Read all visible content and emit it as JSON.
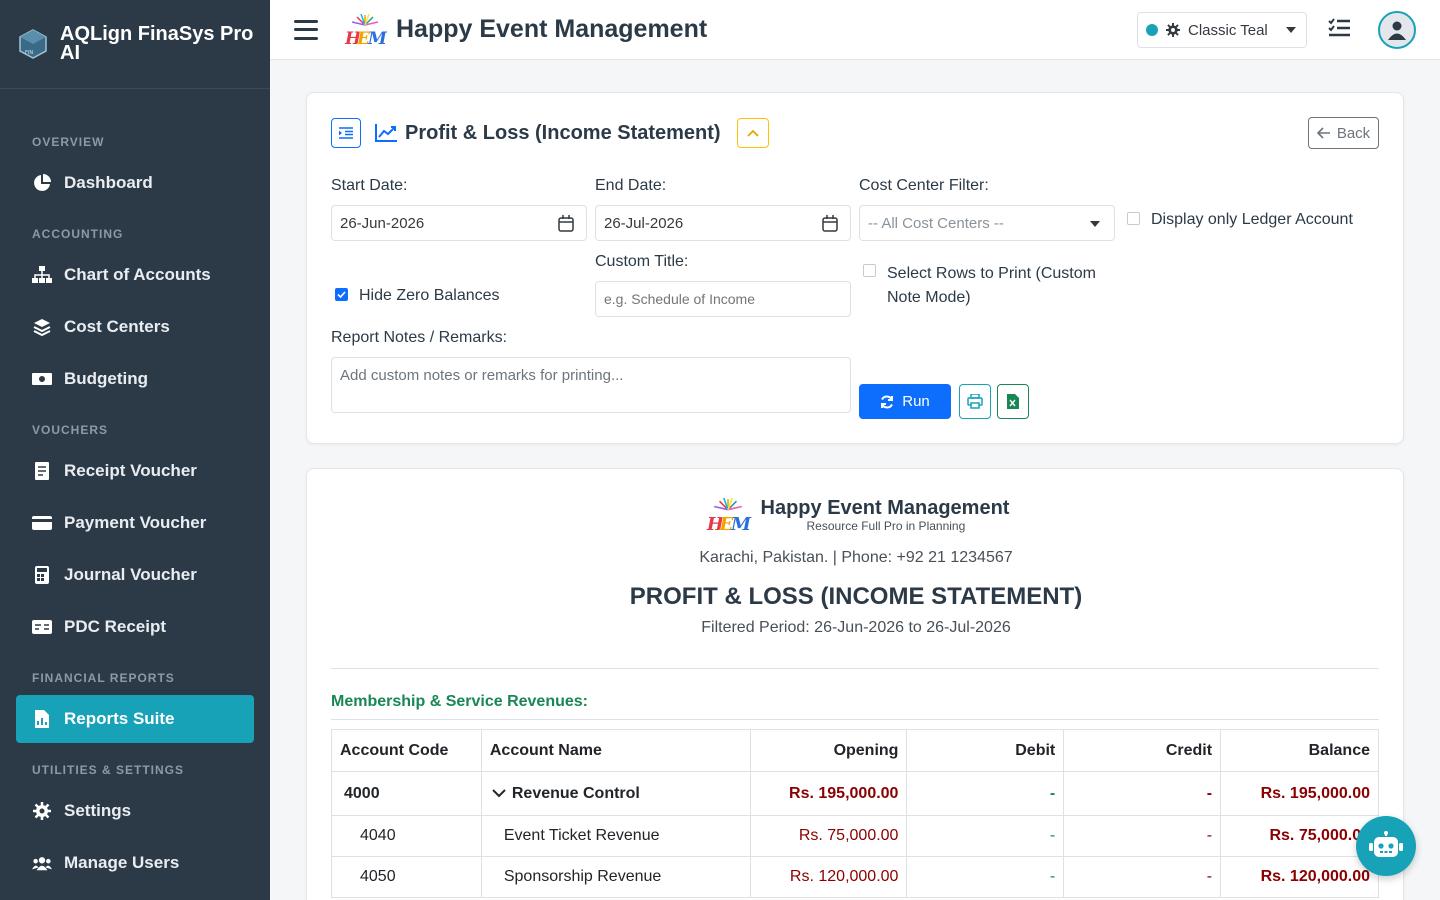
{
  "app": {
    "brand_name": "AQLign FinaSys Pro AI",
    "page_title": "Happy Event Management"
  },
  "colors": {
    "sidebar_bg": "#2c3a47",
    "accent": "#17a2b8",
    "primary": "#0d6efd",
    "revenue_red": "#8b0000",
    "section_green": "#198754"
  },
  "sidebar": {
    "sections": [
      {
        "label": "OVERVIEW",
        "items": [
          {
            "label": "Dashboard",
            "icon": "pie-chart-icon"
          }
        ]
      },
      {
        "label": "ACCOUNTING",
        "items": [
          {
            "label": "Chart of Accounts",
            "icon": "sitemap-icon"
          },
          {
            "label": "Cost Centers",
            "icon": "layers-icon"
          },
          {
            "label": "Budgeting",
            "icon": "money-icon"
          }
        ]
      },
      {
        "label": "VOUCHERS",
        "items": [
          {
            "label": "Receipt Voucher",
            "icon": "receipt-icon"
          },
          {
            "label": "Payment Voucher",
            "icon": "credit-card-icon"
          },
          {
            "label": "Journal Voucher",
            "icon": "calculator-icon"
          },
          {
            "label": "PDC Receipt",
            "icon": "cheque-icon"
          }
        ]
      },
      {
        "label": "FINANCIAL REPORTS",
        "items": [
          {
            "label": "Reports Suite",
            "icon": "file-chart-icon",
            "active": true
          }
        ]
      },
      {
        "label": "UTILITIES & SETTINGS",
        "items": [
          {
            "label": "Settings",
            "icon": "gear-icon"
          },
          {
            "label": "Manage Users",
            "icon": "users-icon"
          }
        ]
      }
    ]
  },
  "topbar": {
    "theme_label": "Classic Teal"
  },
  "filters": {
    "title": "Profit & Loss (Income Statement)",
    "back_label": "Back",
    "start_date_label": "Start Date:",
    "start_date_value": "26-Jun-2026",
    "end_date_label": "End Date:",
    "end_date_value": "26-Jul-2026",
    "cost_center_label": "Cost Center Filter:",
    "cost_center_value": "-- All Cost Centers --",
    "ledger_only_label": "Display only Ledger Account",
    "hide_zero_label": "Hide Zero Balances",
    "custom_title_label": "Custom Title:",
    "custom_title_placeholder": "e.g. Schedule of Income",
    "select_rows_label": "Select Rows to Print (Custom Note Mode)",
    "notes_label": "Report Notes / Remarks:",
    "notes_placeholder": "Add custom notes or remarks for printing...",
    "run_label": "Run"
  },
  "report": {
    "company": "Happy Event Management",
    "tagline": "Resource Full Pro in Planning",
    "address": "Karachi, Pakistan. | Phone: +92 21 1234567",
    "title": "PROFIT & LOSS (INCOME STATEMENT)",
    "period": "Filtered Period: 26-Jun-2026 to 26-Jul-2026",
    "section": "Membership & Service Revenues:",
    "columns": [
      "Account Code",
      "Account Name",
      "Opening",
      "Debit",
      "Credit",
      "Balance"
    ],
    "rows": [
      {
        "code": "4000",
        "name": "Revenue Control",
        "opening": "Rs. 195,000.00",
        "debit": "-",
        "credit": "-",
        "balance": "Rs. 195,000.00",
        "control": true
      },
      {
        "code": "4040",
        "name": "Event Ticket Revenue",
        "opening": "Rs. 75,000.00",
        "debit": "-",
        "credit": "-",
        "balance": "Rs. 75,000.00"
      },
      {
        "code": "4050",
        "name": "Sponsorship Revenue",
        "opening": "Rs. 120,000.00",
        "debit": "-",
        "credit": "-",
        "balance": "Rs. 120,000.00"
      }
    ]
  }
}
